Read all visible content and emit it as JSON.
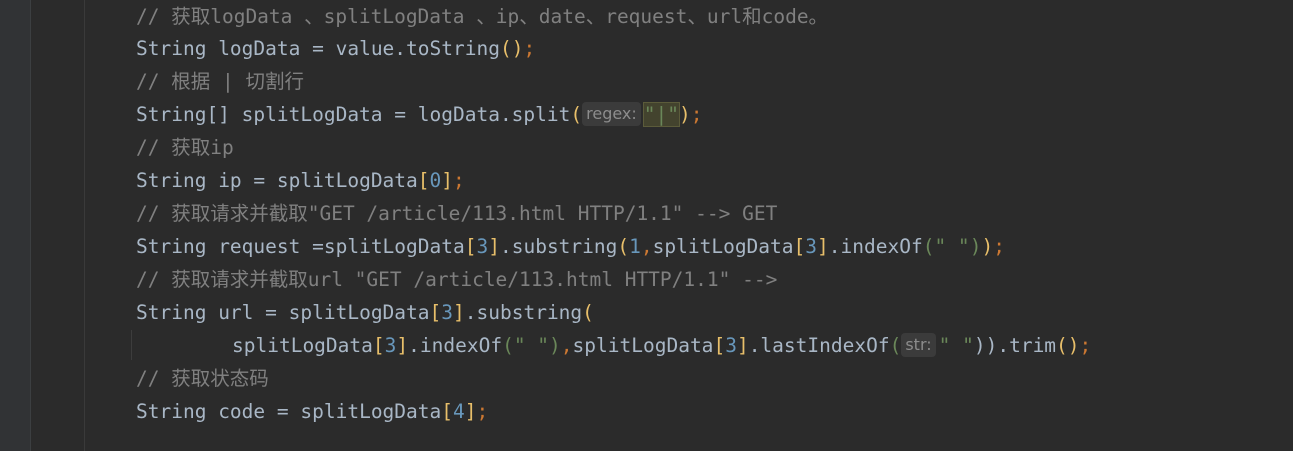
{
  "code_lines": [
    {
      "text": "// 获取logData 、splitLogData 、ip、date、request、url和code。"
    },
    {
      "kw": "String",
      "rest": " logData = value.toString",
      "open": "(",
      "close": ")",
      "semi": ";"
    },
    {
      "text": "// 根据 | 切割行"
    },
    {
      "kw": "String[]",
      "rest": " splitLogData = logData.split",
      "open": "(",
      "hint": "regex:",
      "str": "\"|\"",
      "close": ")",
      "semi": ";"
    },
    {
      "text": "// 获取ip"
    },
    {
      "kw": "String",
      "rest": " ip = splitLogData",
      "lb": "[",
      "num": "0",
      "rb": "]",
      "semi": ";"
    },
    {
      "text": "// 获取请求并截取\"GET /article/113.html HTTP/1.1\" --> GET"
    },
    {
      "kw": "String",
      "rest": " request =splitLogData",
      "a": "[",
      "n1": "3",
      "b": "]",
      "m1": ".substring",
      "p1": "(",
      "n2": "1",
      "comma": ",",
      "m2": "splitLogData",
      "c": "[",
      "n3": "3",
      "d": "]",
      "m3": ".indexOf",
      "p2": "(",
      "str": "\" \"",
      "p3": ")",
      "p4": ")",
      "semi": ";"
    },
    {
      "text": "// 获取请求并截取url \"GET /article/113.html HTTP/1.1\" -->"
    },
    {
      "kw": "String",
      "rest": " url = splitLogData",
      "a": "[",
      "n1": "3",
      "b": "]",
      "m1": ".substring",
      "p1": "("
    },
    {
      "m0": "splitLogData",
      "a": "[",
      "n1": "3",
      "b": "]",
      "m1": ".indexOf",
      "p1": "(",
      "str1": "\" \"",
      "p2": ")",
      "comma": ",",
      "m2": "splitLogData",
      "c": "[",
      "n2": "3",
      "d": "]",
      "m3": ".lastIndexOf",
      "p3": "(",
      "hint": "str:",
      "str2": "\" \"",
      "p4": "))",
      "m4": ".trim",
      "p5": "()",
      "semi": ";"
    },
    {
      "text": "// 获取状态码"
    },
    {
      "kw": "String",
      "rest": " code = splitLogData",
      "lb": "[",
      "num": "4",
      "rb": "]",
      "semi": ";"
    }
  ],
  "colors": {
    "background": "#2b2b2b",
    "gutter": "#313335",
    "comment": "#808080",
    "keyword_punct": "#cc7832",
    "string": "#6a8759",
    "number": "#6897bb",
    "bracket_match": "#e8bf6a",
    "text": "#a9b7c6"
  }
}
